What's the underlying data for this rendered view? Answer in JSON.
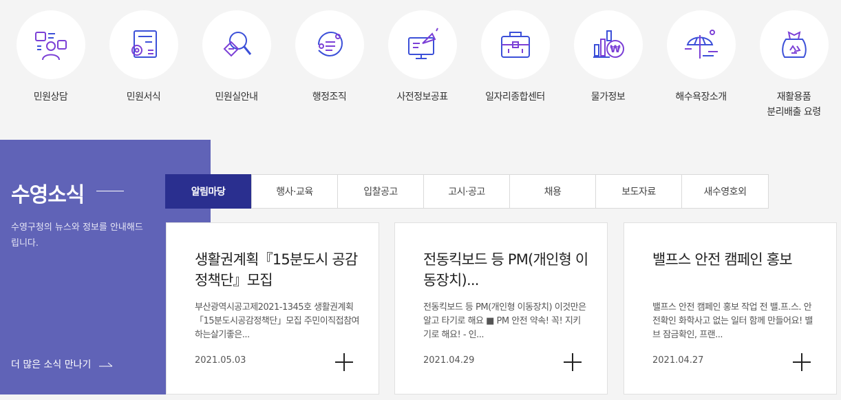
{
  "quick_menu": [
    {
      "label": "민원상담",
      "icon": "consultation-icon"
    },
    {
      "label": "민원서식",
      "icon": "form-settings-icon"
    },
    {
      "label": "민원실안내",
      "icon": "search-guide-icon"
    },
    {
      "label": "행정조직",
      "icon": "organization-icon"
    },
    {
      "label": "사전정보공표",
      "icon": "announcement-monitor-icon"
    },
    {
      "label": "일자리종합센터",
      "icon": "briefcase-icon"
    },
    {
      "label": "물가정보",
      "icon": "price-chart-won-icon"
    },
    {
      "label": "해수욕장소개",
      "icon": "beach-umbrella-icon"
    },
    {
      "label": "재활용품\n분리배출 요령",
      "icon": "recycling-bag-icon"
    }
  ],
  "news": {
    "title": "수영소식",
    "description": "수영구청의 뉴스와 정보를 안내해드립니다.",
    "more_label": "더 많은 소식 만나기"
  },
  "tabs": [
    {
      "label": "알림마당",
      "active": true
    },
    {
      "label": "행사·교육",
      "active": false
    },
    {
      "label": "입찰공고",
      "active": false
    },
    {
      "label": "고시·공고",
      "active": false
    },
    {
      "label": "채용",
      "active": false
    },
    {
      "label": "보도자료",
      "active": false
    },
    {
      "label": "새수영호외",
      "active": false
    }
  ],
  "cards": [
    {
      "title": "생활권계획『15분도시 공감정책단』모집",
      "body": "부산광역시공고제2021-1345호 생활권계획「15분도시공감정책단」모집 주민이직접참여하는살기좋은...",
      "date": "2021.05.03"
    },
    {
      "title": "전동킥보드 등 PM(개인형 이동장치)...",
      "body": "전동킥보드 등 PM(개인형 이동장치) 이것만은 알고 타기로 해요 ■ PM 안전 약속! 꼭! 지키기로 해요! - 인...",
      "date": "2021.04.29"
    },
    {
      "title": "밸프스 안전 캠페인 홍보",
      "body": "밸프스 안전 캠페인 홍보 작업 전 밸.프.스. 안전확인 화학사고 없는 일터 함께 만들어요! 밸브 잠금확인, 프랜...",
      "date": "2021.04.27"
    }
  ],
  "colors": {
    "accent": "#6063b7",
    "active_tab": "#2a2f8f",
    "icon_purple": "#7b3fd6",
    "icon_blue": "#3b4fd8"
  }
}
